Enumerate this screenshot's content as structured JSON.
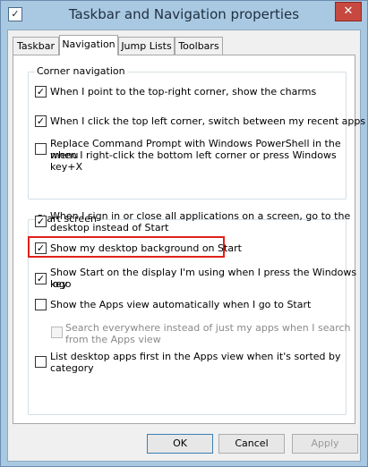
{
  "window": {
    "title": "Taskbar and Navigation properties",
    "close_label": "✕",
    "app_icon": "✓"
  },
  "tabs": [
    {
      "label": "Taskbar"
    },
    {
      "label": "Navigation"
    },
    {
      "label": "Jump Lists"
    },
    {
      "label": "Toolbars"
    }
  ],
  "corner_navigation": {
    "legend": "Corner navigation",
    "items": [
      {
        "label": "When I point to the top-right corner, show the charms",
        "checked": true
      },
      {
        "label": "When I click the top left corner, switch between my recent apps",
        "checked": true
      },
      {
        "label_line1": "Replace Command Prompt with Windows PowerShell in the menu",
        "label_line2": "when I right-click the bottom left corner or press Windows key+X",
        "checked": false
      }
    ]
  },
  "start_screen": {
    "legend": "Start screen",
    "items": [
      {
        "label_line1": "When I sign in or close all applications on a screen, go to the",
        "label_line2": "desktop instead of Start",
        "checked": true
      },
      {
        "label": "Show my desktop background on Start",
        "checked": true
      },
      {
        "label_line1": "Show Start on the display I'm using when I press the Windows logo",
        "label_line2": "key",
        "checked": true
      },
      {
        "label": "Show the Apps view automatically when I go to Start",
        "checked": false
      },
      {
        "label_line1": "Search everywhere instead of just my apps when I search",
        "label_line2": "from the Apps view",
        "checked": false,
        "disabled": true
      },
      {
        "label_line1": "List desktop apps first in the Apps view when it's sorted by",
        "label_line2": "category",
        "checked": false
      }
    ]
  },
  "buttons": {
    "ok": "OK",
    "cancel": "Cancel",
    "apply": "Apply"
  },
  "colors": {
    "highlight": "#e0201b",
    "title_bar": "#a9c9e3"
  }
}
